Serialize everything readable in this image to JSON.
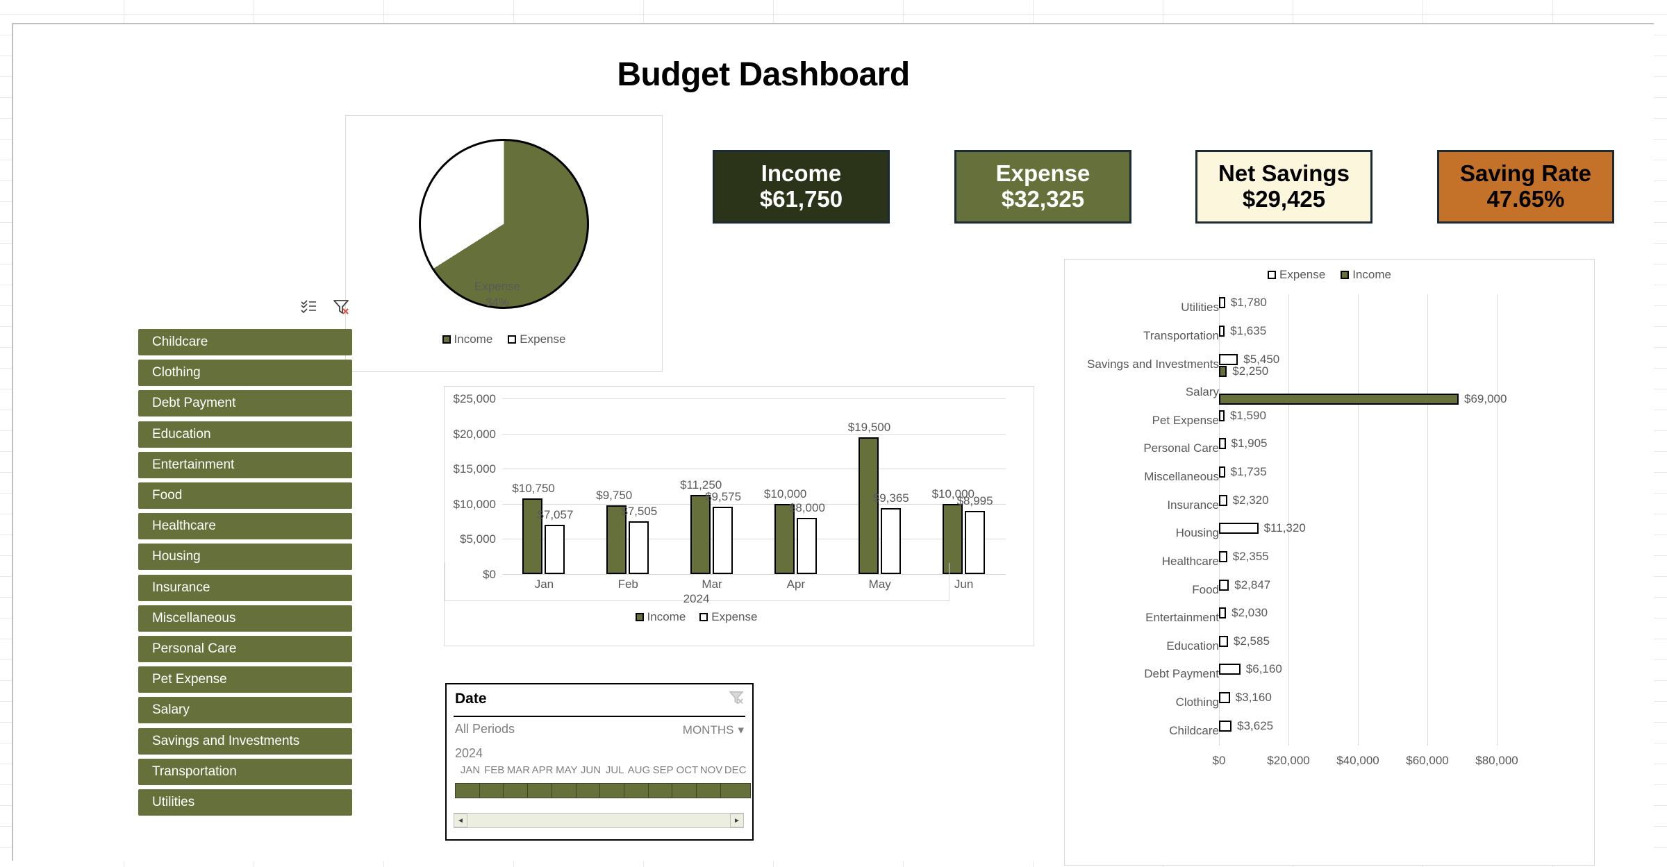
{
  "header": {
    "title": "Budget Dashboard"
  },
  "kpis": [
    {
      "label": "Income",
      "value": "$61,750",
      "bg": "#2b3318",
      "fg": "#ffffff"
    },
    {
      "label": "Expense",
      "value": "$32,325",
      "bg": "#66703a",
      "fg": "#ffffff"
    },
    {
      "label": "Net Savings",
      "value": "$29,425",
      "bg": "#fbf6dc",
      "fg": "#000000"
    },
    {
      "label": "Saving Rate",
      "value": "47.65%",
      "bg": "#c4712a",
      "fg": "#000000"
    }
  ],
  "slicer": {
    "icons": {
      "multiselect": "multi-select-icon",
      "clear": "clear-filter-icon"
    },
    "items": [
      "Childcare",
      "Clothing",
      "Debt Payment",
      "Education",
      "Entertainment",
      "Food",
      "Healthcare",
      "Housing",
      "Insurance",
      "Miscellaneous",
      "Personal Care",
      "Pet Expense",
      "Salary",
      "Savings and Investments",
      "Transportation",
      "Utilities"
    ]
  },
  "timeline": {
    "title": "Date",
    "all_periods": "All Periods",
    "year": "2024",
    "level": "MONTHS",
    "months": [
      "JAN",
      "FEB",
      "MAR",
      "APR",
      "MAY",
      "JUN",
      "JUL",
      "AUG",
      "SEP",
      "OCT",
      "NOV",
      "DEC"
    ],
    "selected": [
      true,
      true,
      true,
      true,
      true,
      true,
      true,
      true,
      true,
      true,
      true,
      true
    ],
    "scroll_left": "◄",
    "scroll_right": "►"
  },
  "chart_data": [
    {
      "id": "income-expense-pie",
      "type": "pie",
      "title": "",
      "labels": [
        "Income",
        "Expense"
      ],
      "values": [
        66,
        34
      ],
      "value_labels": [
        "66%",
        "34%"
      ],
      "legend": [
        "Income",
        "Expense"
      ],
      "legend_position": "bottom",
      "colors": [
        "#66703a",
        "#ffffff"
      ]
    },
    {
      "id": "monthly-income-expense-columns",
      "type": "bar",
      "title": "",
      "categories": [
        "Jan",
        "Feb",
        "Mar",
        "Apr",
        "May",
        "Jun"
      ],
      "series": [
        {
          "name": "Income",
          "values": [
            10750,
            9750,
            11250,
            10000,
            19500,
            10000
          ],
          "labels": [
            "$10,750",
            "$9,750",
            "$11,250",
            "$10,000",
            "$19,500",
            "$10,000"
          ]
        },
        {
          "name": "Expense",
          "values": [
            7057,
            7505,
            9575,
            8000,
            9365,
            8995
          ],
          "labels": [
            "$7,057",
            "$7,505",
            "$9,575",
            "$8,000",
            "$9,365",
            "$8,995"
          ]
        }
      ],
      "xlabel": "2024",
      "ylabel": "",
      "ylim": [
        0,
        25000
      ],
      "yticks": [
        0,
        5000,
        10000,
        15000,
        20000,
        25000
      ],
      "ytick_labels": [
        "$0",
        "$5,000",
        "$10,000",
        "$15,000",
        "$20,000",
        "$25,000"
      ],
      "grid": true,
      "legend": [
        "Income",
        "Expense"
      ],
      "legend_position": "bottom"
    },
    {
      "id": "category-income-expense-bars",
      "type": "bar",
      "orientation": "horizontal",
      "title": "",
      "categories": [
        "Utilities",
        "Transportation",
        "Savings and Investments",
        "Salary",
        "Pet Expense",
        "Personal Care",
        "Miscellaneous",
        "Insurance",
        "Housing",
        "Healthcare",
        "Food",
        "Entertainment",
        "Education",
        "Debt Payment",
        "Clothing",
        "Childcare"
      ],
      "series": [
        {
          "name": "Expense",
          "values": [
            1780,
            1635,
            5450,
            0,
            1590,
            1905,
            1735,
            2320,
            11320,
            2355,
            2847,
            2030,
            2585,
            6160,
            3160,
            3625
          ],
          "labels": [
            "$1,780",
            "$1,635",
            "$5,450",
            "",
            "$1,590",
            "$1,905",
            "$1,735",
            "$2,320",
            "$11,320",
            "$2,355",
            "$2,847",
            "$2,030",
            "$2,585",
            "$6,160",
            "$3,160",
            "$3,625"
          ]
        },
        {
          "name": "Income",
          "values": [
            0,
            0,
            2250,
            69000,
            0,
            0,
            0,
            0,
            0,
            0,
            0,
            0,
            0,
            0,
            0,
            0
          ],
          "labels": [
            "",
            "",
            "$2,250",
            "$69,000",
            "",
            "",
            "",
            "",
            "",
            "",
            "",
            "",
            "",
            "",
            "",
            ""
          ]
        }
      ],
      "xlim": [
        0,
        80000
      ],
      "xticks": [
        0,
        20000,
        40000,
        60000,
        80000
      ],
      "xtick_labels": [
        "$0",
        "$20,000",
        "$40,000",
        "$60,000",
        "$80,000"
      ],
      "grid": true,
      "legend": [
        "Expense",
        "Income"
      ],
      "legend_position": "top"
    }
  ]
}
